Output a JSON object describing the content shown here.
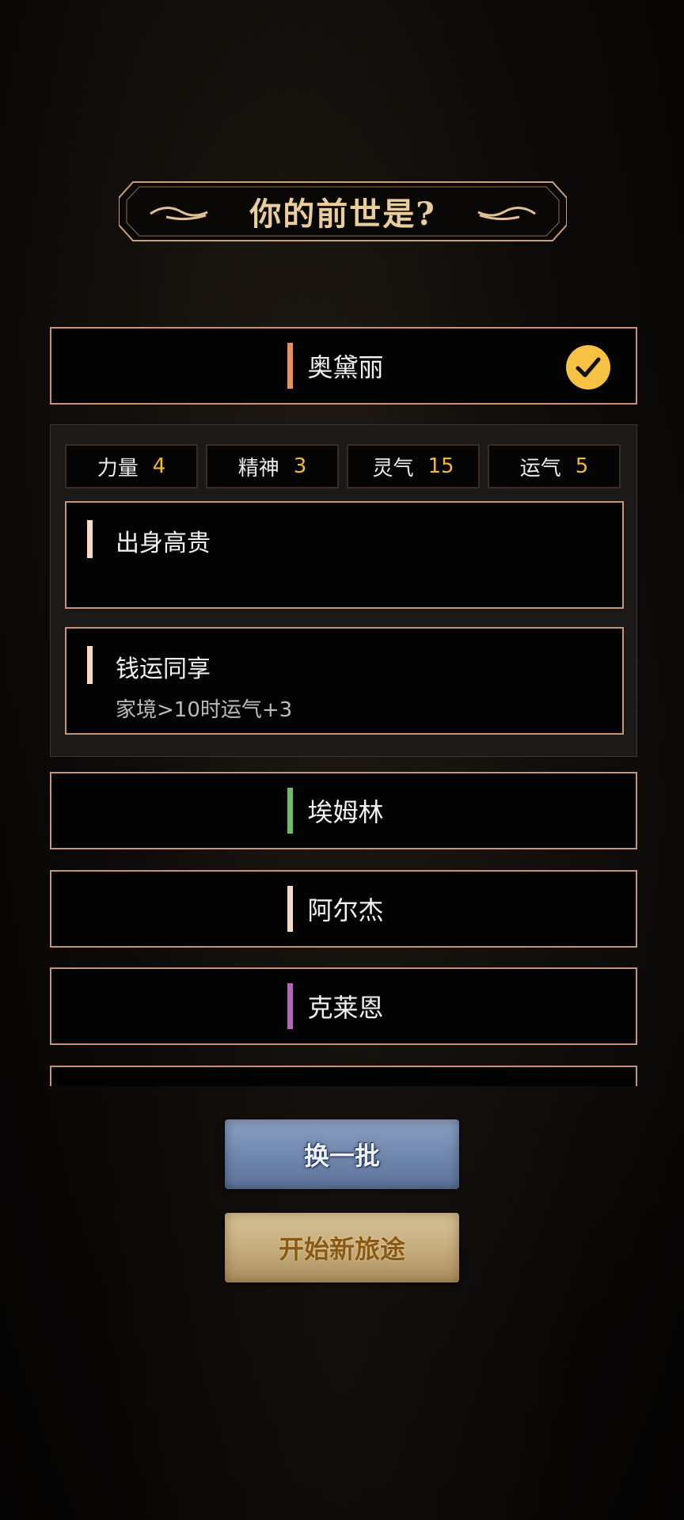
{
  "title": "你的前世是?",
  "selected_character": {
    "name": "奥黛丽",
    "bar_color": "#e8925a",
    "selected": true,
    "stats": [
      {
        "label": "力量",
        "value": "4"
      },
      {
        "label": "精神",
        "value": "3"
      },
      {
        "label": "灵气",
        "value": "15"
      },
      {
        "label": "运气",
        "value": "5"
      }
    ],
    "traits": [
      {
        "name": "出身高贵",
        "desc": ""
      },
      {
        "name": "钱运同享",
        "desc": "家境>10时运气+3"
      }
    ]
  },
  "characters": [
    {
      "name": "埃姆林",
      "bar_color": "#6cbf64"
    },
    {
      "name": "阿尔杰",
      "bar_color": "#f6dcc5"
    },
    {
      "name": "克莱恩",
      "bar_color": "#b566b9"
    },
    {
      "name": "",
      "bar_color": "#6cbf64"
    }
  ],
  "buttons": {
    "refresh_label": "换一批",
    "start_label": "开始新旅途"
  },
  "colors": {
    "accent_gold": "#f7c243",
    "border": "#c99273",
    "stat_value": "#f3b834"
  }
}
